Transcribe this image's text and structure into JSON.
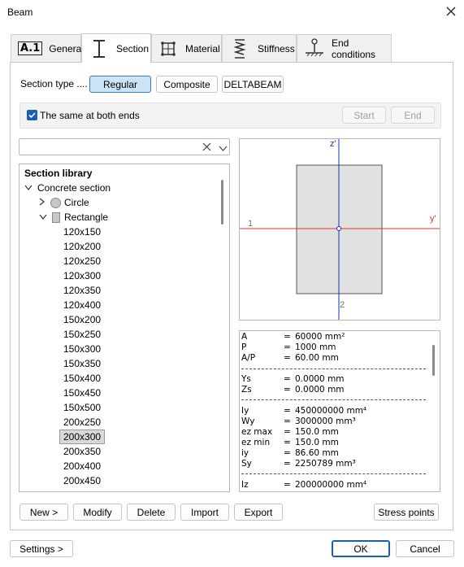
{
  "window": {
    "title": "Beam"
  },
  "tabs": [
    {
      "label": "General",
      "icon": "a1-icon"
    },
    {
      "label": "Section",
      "icon": "i-beam-icon"
    },
    {
      "label": "Material",
      "icon": "material-grid-icon"
    },
    {
      "label": "Stiffness",
      "icon": "spring-icon"
    },
    {
      "label": "End conditions",
      "icon": "support-icon"
    }
  ],
  "section_type": {
    "label": "Section type ....",
    "options": [
      "Regular",
      "Composite",
      "DELTABEAM"
    ],
    "selected": "Regular"
  },
  "ends": {
    "same_label": "The same at both ends",
    "checked": true,
    "start_label": "Start",
    "end_label": "End"
  },
  "search": {
    "value": ""
  },
  "library": {
    "title": "Section library",
    "group": "Concrete section",
    "circle": "Circle",
    "rectangle": "Rectangle",
    "items": [
      "120x150",
      "120x200",
      "120x250",
      "120x300",
      "120x350",
      "120x400",
      "150x200",
      "150x250",
      "150x300",
      "150x350",
      "150x400",
      "150x450",
      "150x500",
      "200x250",
      "200x300",
      "200x350",
      "200x400",
      "200x450"
    ],
    "selected": "200x300"
  },
  "preview": {
    "z_label": "z'",
    "y_label": "y'",
    "point1": "1",
    "point2": "2"
  },
  "properties": {
    "rows": [
      {
        "name": "A",
        "eq": "=",
        "value": "60000 mm²"
      },
      {
        "name": "P",
        "eq": "=",
        "value": "1000 mm"
      },
      {
        "name": "A/P",
        "eq": "=",
        "value": "60.00 mm"
      },
      {
        "name": "Ys",
        "eq": "=",
        "value": "0.0000 mm"
      },
      {
        "name": "Zs",
        "eq": "=",
        "value": "0.0000 mm"
      },
      {
        "name": "Iy",
        "eq": "=",
        "value": "450000000 mm⁴"
      },
      {
        "name": "Wy",
        "eq": "=",
        "value": "3000000 mm³"
      },
      {
        "name": "ez max",
        "eq": "=",
        "value": "150.0 mm"
      },
      {
        "name": "ez min",
        "eq": "=",
        "value": "150.0 mm"
      },
      {
        "name": "iy",
        "eq": "=",
        "value": "86.60 mm"
      },
      {
        "name": "Sy",
        "eq": "=",
        "value": "2250789 mm³"
      },
      {
        "name": "Iz",
        "eq": "=",
        "value": "200000000 mm⁴"
      }
    ]
  },
  "actions": {
    "new": "New >",
    "modify": "Modify",
    "delete": "Delete",
    "import": "Import",
    "export": "Export",
    "stress_points": "Stress points"
  },
  "footer": {
    "settings": "Settings >",
    "ok": "OK",
    "cancel": "Cancel"
  },
  "colors": {
    "accent": "#1a5fb4",
    "selected_bg": "#cce4f7",
    "axis_y": "#e03030",
    "axis_z": "#1a2fb4",
    "section_fill": "#e1e1e1"
  }
}
